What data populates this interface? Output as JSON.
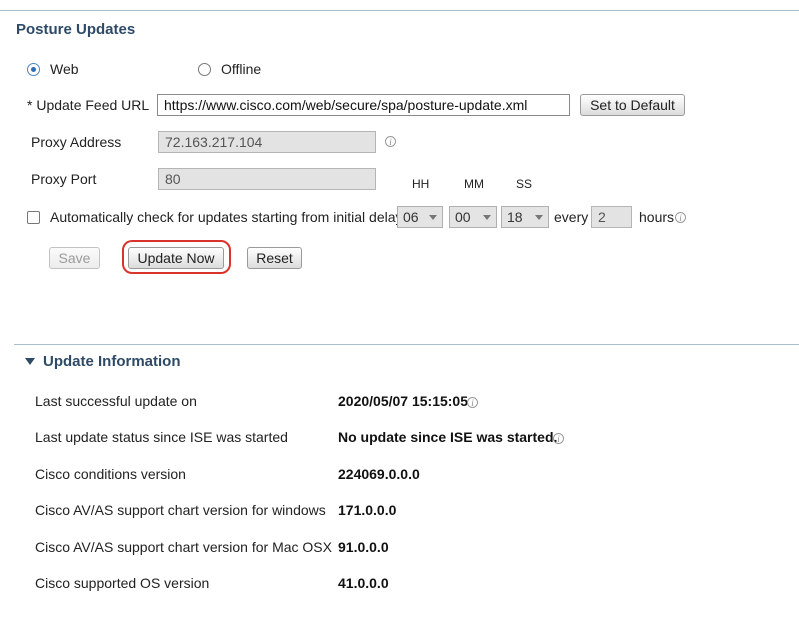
{
  "posture": {
    "title": "Posture Updates",
    "source_options": [
      {
        "label": "Web",
        "selected": true
      },
      {
        "label": "Offline",
        "selected": false
      }
    ],
    "feed_url_label": "* Update Feed URL",
    "feed_url_value": "https://www.cisco.com/web/secure/spa/posture-update.xml",
    "set_default_label": "Set to Default",
    "proxy_address_label": "Proxy Address",
    "proxy_address_value": "72.163.217.104",
    "proxy_port_label": "Proxy Port",
    "proxy_port_value": "80",
    "time_headers": {
      "hh": "HH",
      "mm": "MM",
      "ss": "SS"
    },
    "auto_check_label": "Automatically check for updates starting from initial delay",
    "auto_check_checked": false,
    "hh_value": "06",
    "mm_value": "00",
    "ss_value": "18",
    "every_label": "every",
    "every_value": "2",
    "hours_label": "hours",
    "buttons": {
      "save": "Save",
      "update_now": "Update Now",
      "reset": "Reset"
    },
    "highlight_color": "#d9342b"
  },
  "update_info": {
    "title": "Update Information",
    "rows": [
      {
        "label": "Last successful update on",
        "value": "2020/05/07 15:15:05"
      },
      {
        "label": "Last update status since ISE was started",
        "value": "No update since ISE was started."
      },
      {
        "label": "Cisco conditions version",
        "value": "224069.0.0.0"
      },
      {
        "label": "Cisco AV/AS support chart version for windows",
        "value": "171.0.0.0"
      },
      {
        "label": "Cisco AV/AS support chart version for Mac OSX",
        "value": "91.0.0.0"
      },
      {
        "label": "Cisco supported OS version",
        "value": "41.0.0.0"
      }
    ]
  },
  "icons": {
    "info": "info-icon",
    "collapse": "triangle-down-icon"
  }
}
